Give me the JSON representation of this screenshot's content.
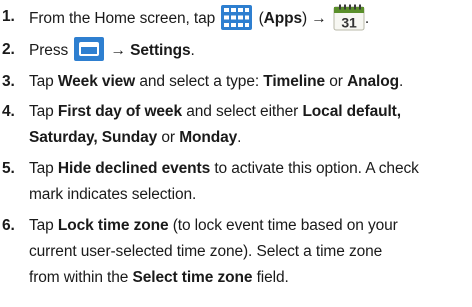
{
  "steps": [
    {
      "number": "1.",
      "t1": "From the Home screen, tap ",
      "t2": " (",
      "t3": "Apps",
      "t4": ") → ",
      "t5": "."
    },
    {
      "number": "2.",
      "t1": "Press ",
      "t2": " → ",
      "t3": "Settings",
      "t4": "."
    },
    {
      "number": "3.",
      "t1": "Tap ",
      "t2": "Week view",
      "t3": " and select a type: ",
      "t4": "Timeline",
      "t5": " or ",
      "t6": "Analog",
      "t7": "."
    },
    {
      "number": "4.",
      "t1": "Tap ",
      "t2": "First day of week",
      "t3": " and select either ",
      "t4": "Local default,",
      "t5": "Saturday, Sunday",
      "t6": " or ",
      "t7": "Monday",
      "t8": "."
    },
    {
      "number": "5.",
      "t1": "Tap ",
      "t2": "Hide declined events",
      "t3": " to activate this option. A check",
      "t4": "mark indicates selection."
    },
    {
      "number": "6.",
      "t1": "Tap ",
      "t2": "Lock time zone",
      "t3": " (to lock event time based on your",
      "t4": "current user-selected time zone). Select a time zone",
      "t5": "from within the ",
      "t6": "Select time zone",
      "t7": " field."
    }
  ],
  "calendar_icon": {
    "day": "31",
    "header_color": "#5a8f2a"
  },
  "icons": {
    "apps": "apps-grid-icon",
    "menu": "menu-icon",
    "calendar": "calendar-icon"
  },
  "colors": {
    "apps_icon": "#2e7fd0",
    "menu_icon": "#2e7fd0",
    "text": "#1a1a1a"
  }
}
